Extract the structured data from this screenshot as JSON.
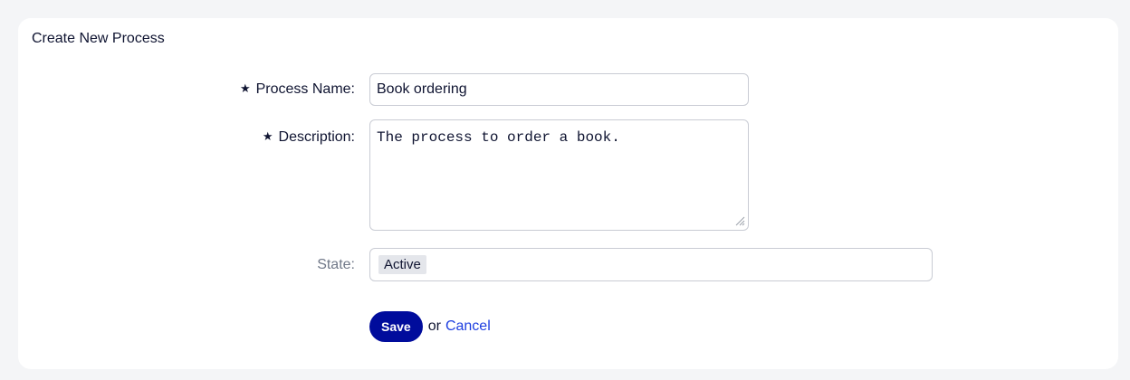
{
  "form": {
    "title": "Create New Process",
    "process_name": {
      "required_marker": "★",
      "label": "Process Name:",
      "value": "Book ordering"
    },
    "description": {
      "required_marker": "★",
      "label": "Description:",
      "value": "The process to order a book."
    },
    "state": {
      "label": "State:",
      "selected": "Active"
    },
    "actions": {
      "save_label": "Save",
      "or_text": "or",
      "cancel_label": "Cancel"
    }
  },
  "colors": {
    "accent": "#000c9c",
    "link": "#1e3fe0",
    "background": "#f4f5f7"
  }
}
